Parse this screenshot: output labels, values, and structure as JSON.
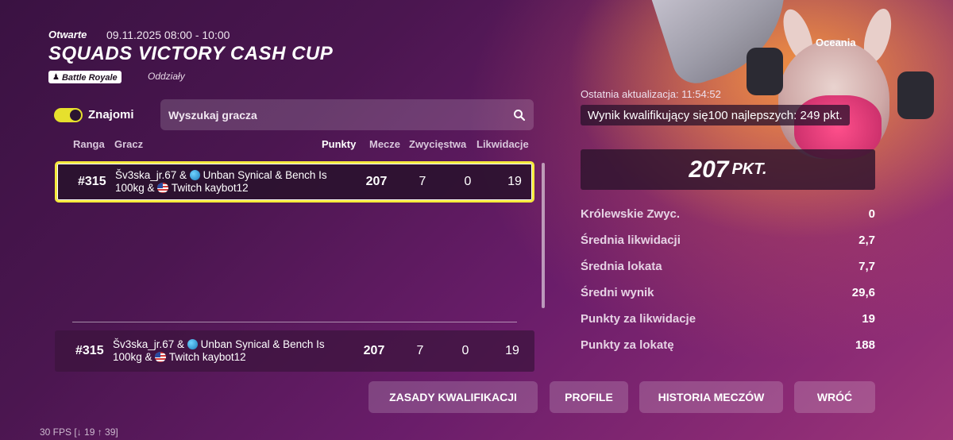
{
  "event": {
    "status": "Otwarte",
    "date": "09.11.2025 08:00 - 10:00",
    "title": "SQUADS VICTORY CASH CUP",
    "mode": "Battle Royale",
    "mode_sub": "Oddziały",
    "region": "Oceania"
  },
  "filters": {
    "friends_label": "Znajomi",
    "friends_on": true,
    "search_placeholder": "Wyszukaj gracza",
    "search_value": ""
  },
  "columns": {
    "rank": "Ranga",
    "player": "Gracz",
    "points": "Punkty",
    "matches": "Mecze",
    "wins": "Zwycięstwa",
    "kills": "Likwidacje"
  },
  "rows": [
    {
      "rank": "#315",
      "p1": "Šv3ska_jr.67 &",
      "p2": "Unban Synical & Bench Is",
      "p3": "100kg &",
      "p4": "Twitch kaybot12",
      "points": "207",
      "matches": "7",
      "wins": "0",
      "kills": "19"
    }
  ],
  "pinned": {
    "rank": "#315",
    "p1": "Šv3ska_jr.67 &",
    "p2": "Unban Synical & Bench Is",
    "p3": "100kg &",
    "p4": "Twitch kaybot12",
    "points": "207",
    "matches": "7",
    "wins": "0",
    "kills": "19"
  },
  "details": {
    "updated": "Ostatnia aktualizacja: 11:54:52",
    "qualifying": "Wynik kwalifikujący się100 najlepszych: 249 pkt.",
    "score": "207",
    "score_unit": "PKT.",
    "stats": [
      {
        "label": "Królewskie Zwyc.",
        "value": "0"
      },
      {
        "label": "Średnia likwidacji",
        "value": "2,7"
      },
      {
        "label": "Średnia lokata",
        "value": "7,7"
      },
      {
        "label": "Średni wynik",
        "value": "29,6"
      },
      {
        "label": "Punkty za likwidacje",
        "value": "19"
      },
      {
        "label": "Punkty za lokatę",
        "value": "188"
      }
    ]
  },
  "buttons": {
    "rules": "ZASADY KWALIFIKACJI",
    "profile": "PROFILE",
    "history": "HISTORIA MECZÓW",
    "back": "WRÓĆ"
  },
  "fps": "30 FPS [↓ 19 ↑ 39]",
  "colors": {
    "accent_yellow": "#f5e93c",
    "toggle_on": "#e6e02d"
  }
}
